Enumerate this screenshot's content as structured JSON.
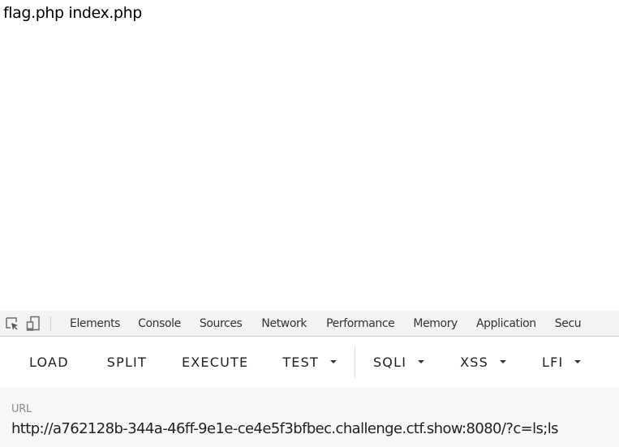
{
  "page": {
    "content_text": "flag.php index.php"
  },
  "devtools": {
    "icons": [
      {
        "name": "inspect-element-icon"
      },
      {
        "name": "device-toggle-icon"
      }
    ],
    "tabs": [
      {
        "label": "Elements"
      },
      {
        "label": "Console"
      },
      {
        "label": "Sources"
      },
      {
        "label": "Network"
      },
      {
        "label": "Performance"
      },
      {
        "label": "Memory"
      },
      {
        "label": "Application"
      },
      {
        "label": "Secu"
      }
    ]
  },
  "hackbar": {
    "buttons": [
      {
        "label": "LOAD",
        "dropdown": false
      },
      {
        "label": "SPLIT",
        "dropdown": false
      },
      {
        "label": "EXECUTE",
        "dropdown": false
      },
      {
        "label": "TEST",
        "dropdown": true
      },
      {
        "label": "SQLI",
        "dropdown": true
      },
      {
        "label": "XSS",
        "dropdown": true
      },
      {
        "label": "LFI",
        "dropdown": true
      }
    ]
  },
  "url_panel": {
    "label": "URL",
    "value": "http://a762128b-344a-46ff-9e1e-ce4e5f3bfbec.challenge.ctf.show:8080/?c=ls;ls"
  }
}
